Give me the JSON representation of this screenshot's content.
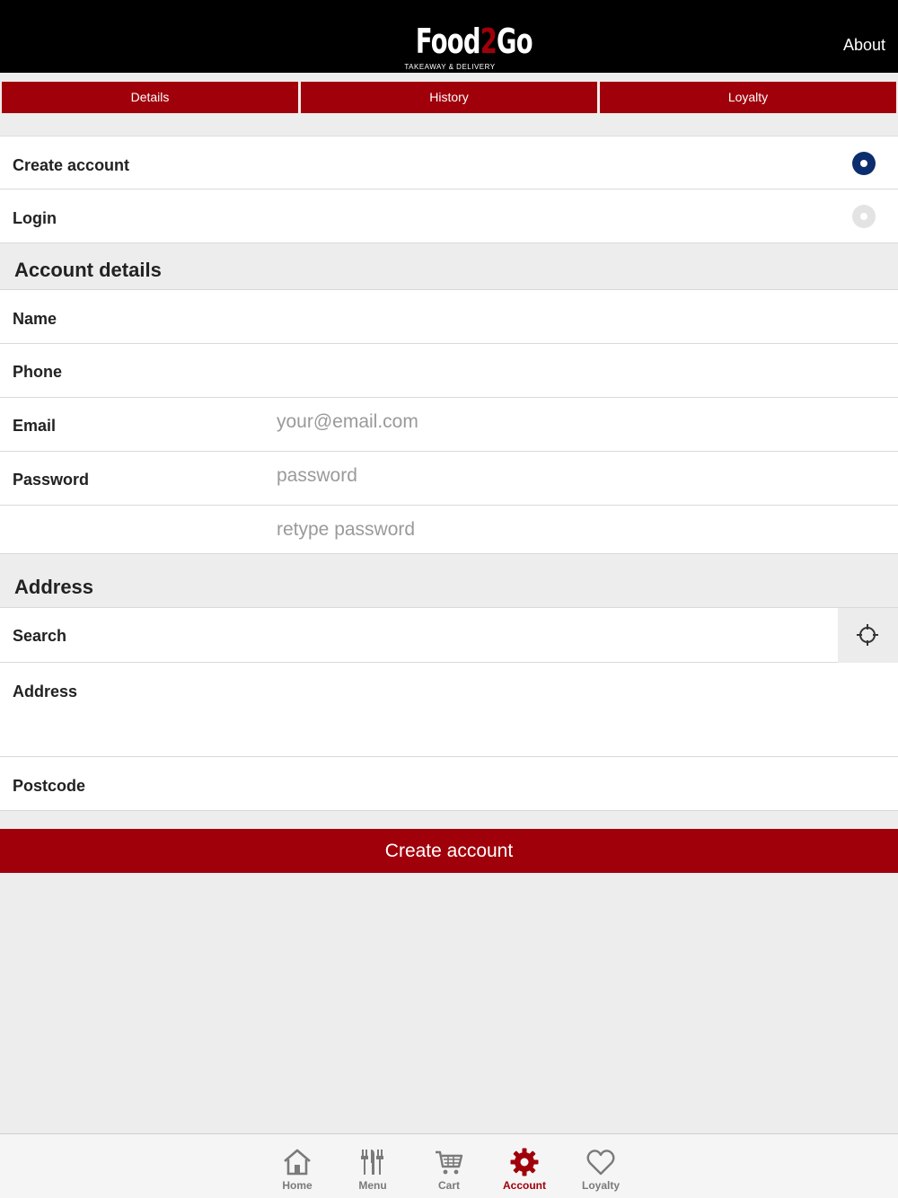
{
  "header": {
    "logo_text_1": "Food",
    "logo_text_2": "2",
    "logo_text_3": "Go",
    "logo_tagline": "TAKEAWAY & DELIVERY",
    "about_label": "About"
  },
  "tabs": [
    {
      "label": "Details"
    },
    {
      "label": "History"
    },
    {
      "label": "Loyalty"
    }
  ],
  "mode": {
    "create_label": "Create account",
    "login_label": "Login",
    "selected": "Create account"
  },
  "account": {
    "title": "Account details",
    "name_label": "Name",
    "phone_label": "Phone",
    "email_label": "Email",
    "email_placeholder": "your@email.com",
    "password_label": "Password",
    "password_placeholder": "password",
    "retype_placeholder": "retype password"
  },
  "address": {
    "title": "Address",
    "search_label": "Search",
    "address_label": "Address",
    "postcode_label": "Postcode"
  },
  "submit_label": "Create account",
  "bottom_nav": [
    {
      "label": "Home",
      "icon": "home-icon"
    },
    {
      "label": "Menu",
      "icon": "cutlery-icon"
    },
    {
      "label": "Cart",
      "icon": "cart-icon"
    },
    {
      "label": "Account",
      "icon": "gear-icon"
    },
    {
      "label": "Loyalty",
      "icon": "heart-icon"
    }
  ],
  "colors": {
    "brand_red": "#a0000a",
    "radio_selected": "#0c2e6e",
    "background": "#ededed",
    "header_black": "#000000"
  }
}
